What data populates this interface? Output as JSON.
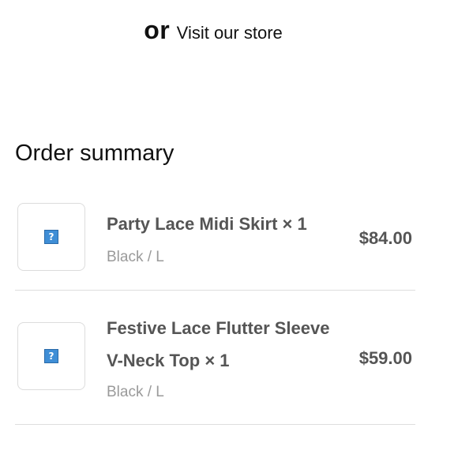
{
  "store_prompt": {
    "or_label": "or",
    "link_label": "Visit our store"
  },
  "order_summary": {
    "title": "Order summary",
    "items": [
      {
        "name": "Party Lace Midi Skirt",
        "quantity": "× 1",
        "variant": "Black / L",
        "price": "$84.00",
        "image_icon": "broken-image-icon"
      },
      {
        "name": "Festive Lace Flutter Sleeve V-Neck Top",
        "quantity": "× 1",
        "variant": "Black / L",
        "price": "$59.00",
        "image_icon": "broken-image-icon"
      }
    ]
  },
  "colors": {
    "text_primary": "#111111",
    "text_item": "#555555",
    "text_muted": "#9a9a9a",
    "divider": "#dedede"
  }
}
